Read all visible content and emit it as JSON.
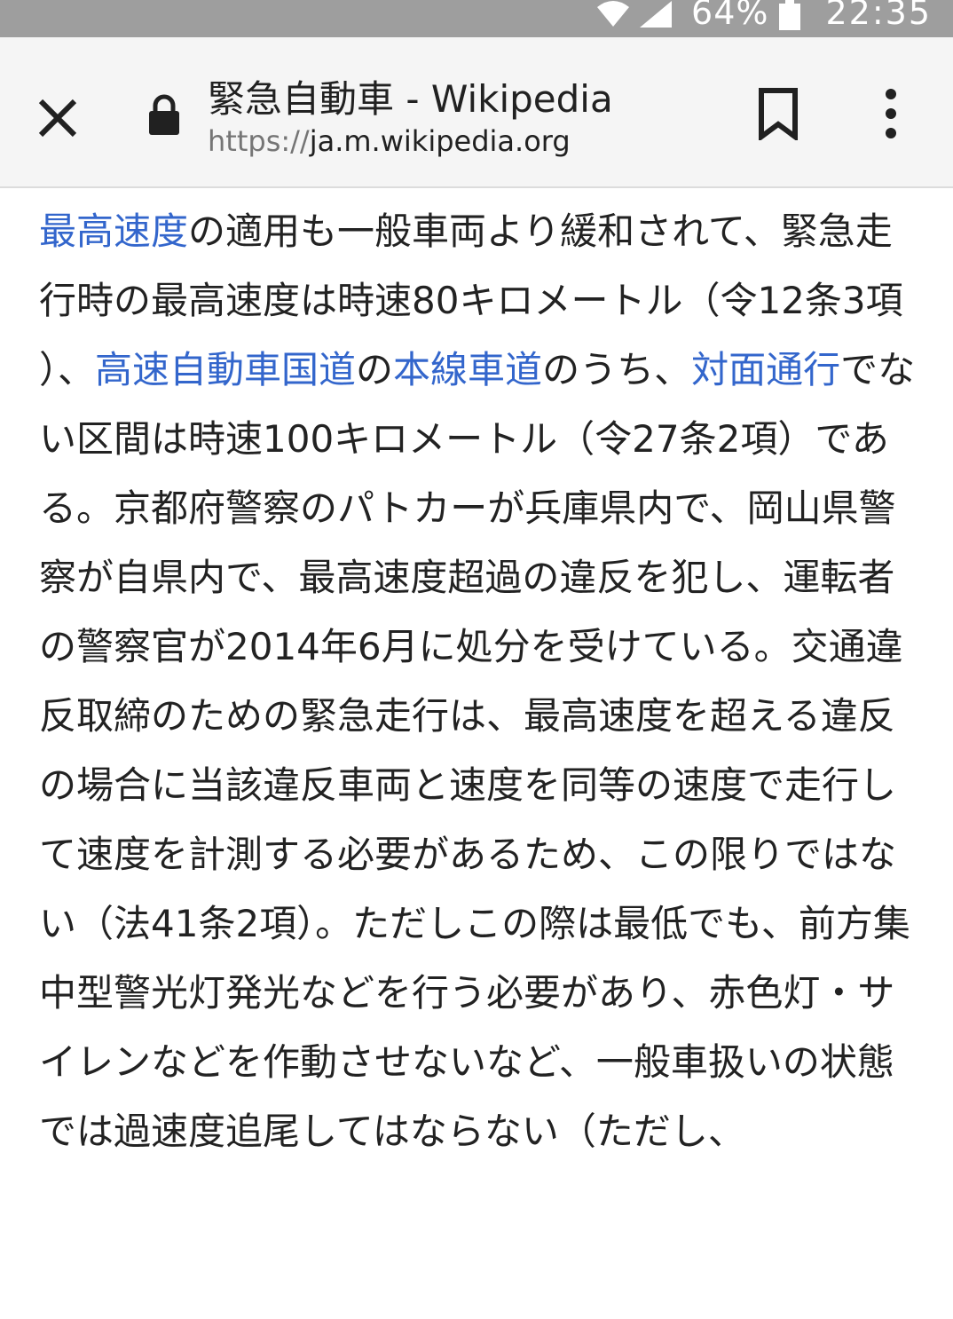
{
  "status_bar": {
    "battery": "64%",
    "time": "22:35"
  },
  "toolbar": {
    "title": "緊急自動車 - Wikipedia",
    "url_scheme": "https://",
    "url_host": "ja.m.wikipedia.org"
  },
  "article": {
    "segments": [
      {
        "text": "最高速度",
        "link": true
      },
      {
        "text": "の適用も一般車両より緩和されて、緊急走行時の最高速度は時速80キロメートル（令12条3項）、",
        "link": false
      },
      {
        "text": "高速自動車国道",
        "link": true
      },
      {
        "text": "の",
        "link": false
      },
      {
        "text": "本線車道",
        "link": true
      },
      {
        "text": "のうち、",
        "link": false
      },
      {
        "text": "対面通行",
        "link": true
      },
      {
        "text": "でない区間は時速100キロメートル（令27条2項）である。京都府警察のパトカーが兵庫県内で、岡山県警察が自県内で、最高速度超過の違反を犯し、運転者の警察官が2014年6月に処分を受けている。交通違反取締のための緊急走行は、最高速度を超える違反の場合に当該違反車両と速度を同等の速度で走行して速度を計測する必要があるため、この限りではない（法41条2項）。ただしこの際は最低でも、前方集中型警光灯発光などを行う必要があり、赤色灯・サイレンなどを作動させないなど、一般車扱いの状態では過速度追尾してはならない（ただし、",
        "link": false
      }
    ]
  },
  "colors": {
    "link": "#3366cc",
    "text": "#222222",
    "status_bar": "#9e9e9e",
    "toolbar": "#f5f5f5"
  }
}
